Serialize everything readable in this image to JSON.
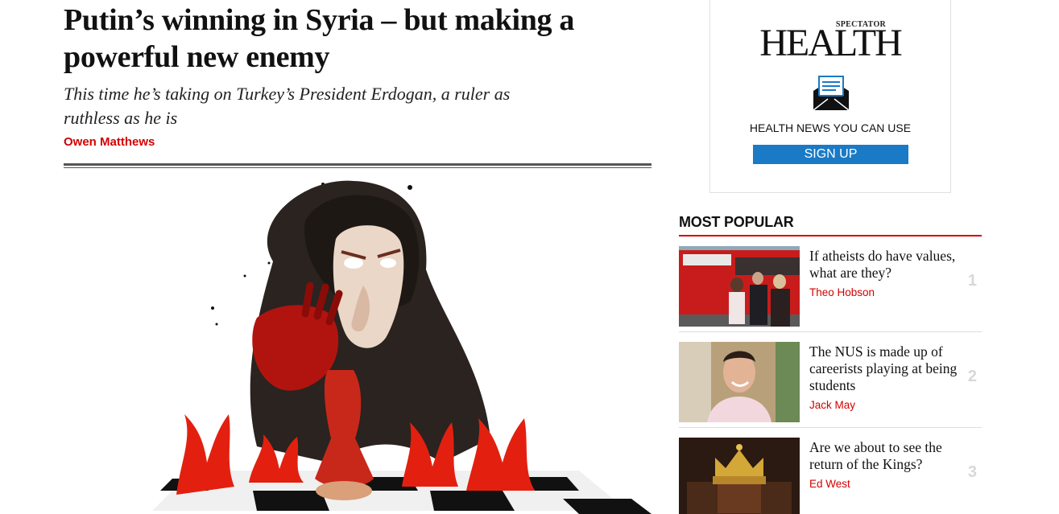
{
  "article": {
    "headline": "Putin’s winning in Syria – but making a powerful new enemy",
    "standfirst": "This time he’s taking on Turkey’s President Erdogan, a ruler as ruthless as he is",
    "author": "Owen Matthews",
    "hero_image": "putin-chess-cartoon"
  },
  "ad": {
    "brand_small": "SPECTATOR",
    "brand_large": "HEALTH",
    "icon": "envelope-newsletter-icon",
    "tagline": "HEALTH NEWS YOU CAN USE",
    "cta": "SIGN UP",
    "cta_color": "#1a7ac6"
  },
  "most_popular": {
    "heading": "MOST POPULAR",
    "accent_color": "#d40000",
    "items": [
      {
        "title": "If atheists do have values, what are they?",
        "author": "Theo Hobson",
        "rank": "1",
        "thumb": "atheist-bus-photo"
      },
      {
        "title": "The NUS is made up of careerists playing at being students",
        "author": "Jack May",
        "rank": "2",
        "thumb": "man-portrait-photo"
      },
      {
        "title": "Are we about to see the return of the Kings?",
        "author": "Ed West",
        "rank": "3",
        "thumb": "crown-photo"
      }
    ]
  }
}
